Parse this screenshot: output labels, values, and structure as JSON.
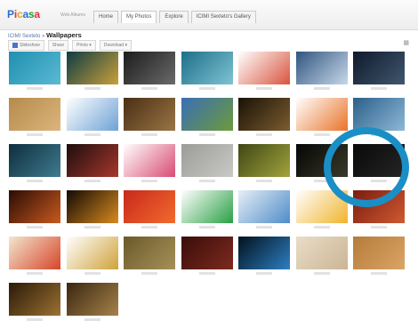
{
  "header": {
    "logo_text": "Picasa",
    "logo_suffix": "Web Albums",
    "account_text": "",
    "tabs": [
      {
        "label": "Home",
        "active": false
      },
      {
        "label": "My Photos",
        "active": true
      },
      {
        "label": "Explore",
        "active": false
      },
      {
        "label": "ICIMI Sexteto's Gallery",
        "active": false
      }
    ]
  },
  "breadcrumb": {
    "owner": "ICIMI Sexteto",
    "separator": "»",
    "album": "Wallpapers"
  },
  "toolbar": {
    "slideshow_label": "Slideshow",
    "share_label": "Share",
    "prints_label": "Prints ▾",
    "download_label": "Download ▾"
  },
  "highlight_color": "#1a8fc6",
  "photos": [
    {
      "row": 0,
      "col": 0,
      "name": "teal-grass",
      "c1": "#1f8fb0",
      "c2": "#5bbad3"
    },
    {
      "row": 0,
      "col": 1,
      "name": "gold-swirl",
      "c1": "#0d3b44",
      "c2": "#c9a13a"
    },
    {
      "row": 0,
      "col": 2,
      "name": "dark-circles",
      "c1": "#1c1c1c",
      "c2": "#6a6a6a"
    },
    {
      "row": 0,
      "col": 3,
      "name": "blue-abstract",
      "c1": "#1d6f88",
      "c2": "#7fc3d4"
    },
    {
      "row": 0,
      "col": 4,
      "name": "red-stripes",
      "c1": "#ffffff",
      "c2": "#d8553f"
    },
    {
      "row": 0,
      "col": 5,
      "name": "skyscraper",
      "c1": "#31557f",
      "c2": "#c7d8e9"
    },
    {
      "row": 0,
      "col": 6,
      "name": "dark-blue-lights",
      "c1": "#0f1a2c",
      "c2": "#40566e"
    },
    {
      "row": 1,
      "col": 0,
      "name": "sand-texture",
      "c1": "#b58a4c",
      "c2": "#dcb57c"
    },
    {
      "row": 1,
      "col": 1,
      "name": "blue-splash",
      "c1": "#ffffff",
      "c2": "#6ea2d4"
    },
    {
      "row": 1,
      "col": 2,
      "name": "brown-grunge",
      "c1": "#4a2f14",
      "c2": "#9a7445"
    },
    {
      "row": 1,
      "col": 3,
      "name": "green-road",
      "c1": "#3a6fb5",
      "c2": "#6c9a3b"
    },
    {
      "row": 1,
      "col": 4,
      "name": "dark-vignette",
      "c1": "#1a1207",
      "c2": "#7b5c2f"
    },
    {
      "row": 1,
      "col": 5,
      "name": "orange-wave",
      "c1": "#ffffff",
      "c2": "#e8742a"
    },
    {
      "row": 1,
      "col": 6,
      "name": "blue-gradient",
      "c1": "#2b5f8a",
      "c2": "#8db8d6"
    },
    {
      "row": 2,
      "col": 0,
      "name": "teal-dark",
      "c1": "#0e2e3d",
      "c2": "#3f7b8f"
    },
    {
      "row": 2,
      "col": 1,
      "name": "red-sparks",
      "c1": "#1d0d0d",
      "c2": "#a7382d"
    },
    {
      "row": 2,
      "col": 2,
      "name": "flower-pattern",
      "c1": "#ffffff",
      "c2": "#d74c72"
    },
    {
      "row": 2,
      "col": 3,
      "name": "grey-stone",
      "c1": "#9b9b98",
      "c2": "#c9c9c5"
    },
    {
      "row": 2,
      "col": 4,
      "name": "green-curl",
      "c1": "#3e4714",
      "c2": "#a3a33d"
    },
    {
      "row": 2,
      "col": 5,
      "name": "black-glow",
      "c1": "#050505",
      "c2": "#3a3a2a"
    },
    {
      "row": 2,
      "col": 6,
      "name": "black-plain",
      "c1": "#080808",
      "c2": "#262626"
    },
    {
      "row": 3,
      "col": 0,
      "name": "orange-fibers",
      "c1": "#2a0c05",
      "c2": "#c85a1e"
    },
    {
      "row": 3,
      "col": 1,
      "name": "bokeh-lights",
      "c1": "#120a04",
      "c2": "#d98a1f"
    },
    {
      "row": 3,
      "col": 2,
      "name": "red-orange",
      "c1": "#c8281b",
      "c2": "#f26b2e"
    },
    {
      "row": 3,
      "col": 3,
      "name": "green-field",
      "c1": "#ffffff",
      "c2": "#2aa044"
    },
    {
      "row": 3,
      "col": 4,
      "name": "blue-paper",
      "c1": "#e6eef6",
      "c2": "#4f8cc9"
    },
    {
      "row": 3,
      "col": 5,
      "name": "pencil",
      "c1": "#ffffff",
      "c2": "#f0b42d"
    },
    {
      "row": 3,
      "col": 6,
      "name": "red-tone",
      "c1": "#7a1c10",
      "c2": "#cf5a31"
    },
    {
      "row": 4,
      "col": 0,
      "name": "colored-pencils",
      "c1": "#f3e6cf",
      "c2": "#d6462a"
    },
    {
      "row": 4,
      "col": 1,
      "name": "toy-figure",
      "c1": "#ffffff",
      "c2": "#cfa23a"
    },
    {
      "row": 4,
      "col": 2,
      "name": "olive-texture",
      "c1": "#6a5a2a",
      "c2": "#a69058"
    },
    {
      "row": 4,
      "col": 3,
      "name": "dark-red-texture",
      "c1": "#3a0d0a",
      "c2": "#7d2a1f"
    },
    {
      "row": 4,
      "col": 4,
      "name": "spotlight",
      "c1": "#02111d",
      "c2": "#2d7fc2"
    },
    {
      "row": 4,
      "col": 5,
      "name": "light-sand",
      "c1": "#e9ddc8",
      "c2": "#cbb594"
    },
    {
      "row": 4,
      "col": 6,
      "name": "wood-grain",
      "c1": "#b57b3a",
      "c2": "#dba566"
    },
    {
      "row": 5,
      "col": 0,
      "name": "dark-sepia",
      "c1": "#2b1a08",
      "c2": "#9b7132"
    },
    {
      "row": 5,
      "col": 1,
      "name": "brown-sepia",
      "c1": "#3a2610",
      "c2": "#a6824a"
    }
  ]
}
